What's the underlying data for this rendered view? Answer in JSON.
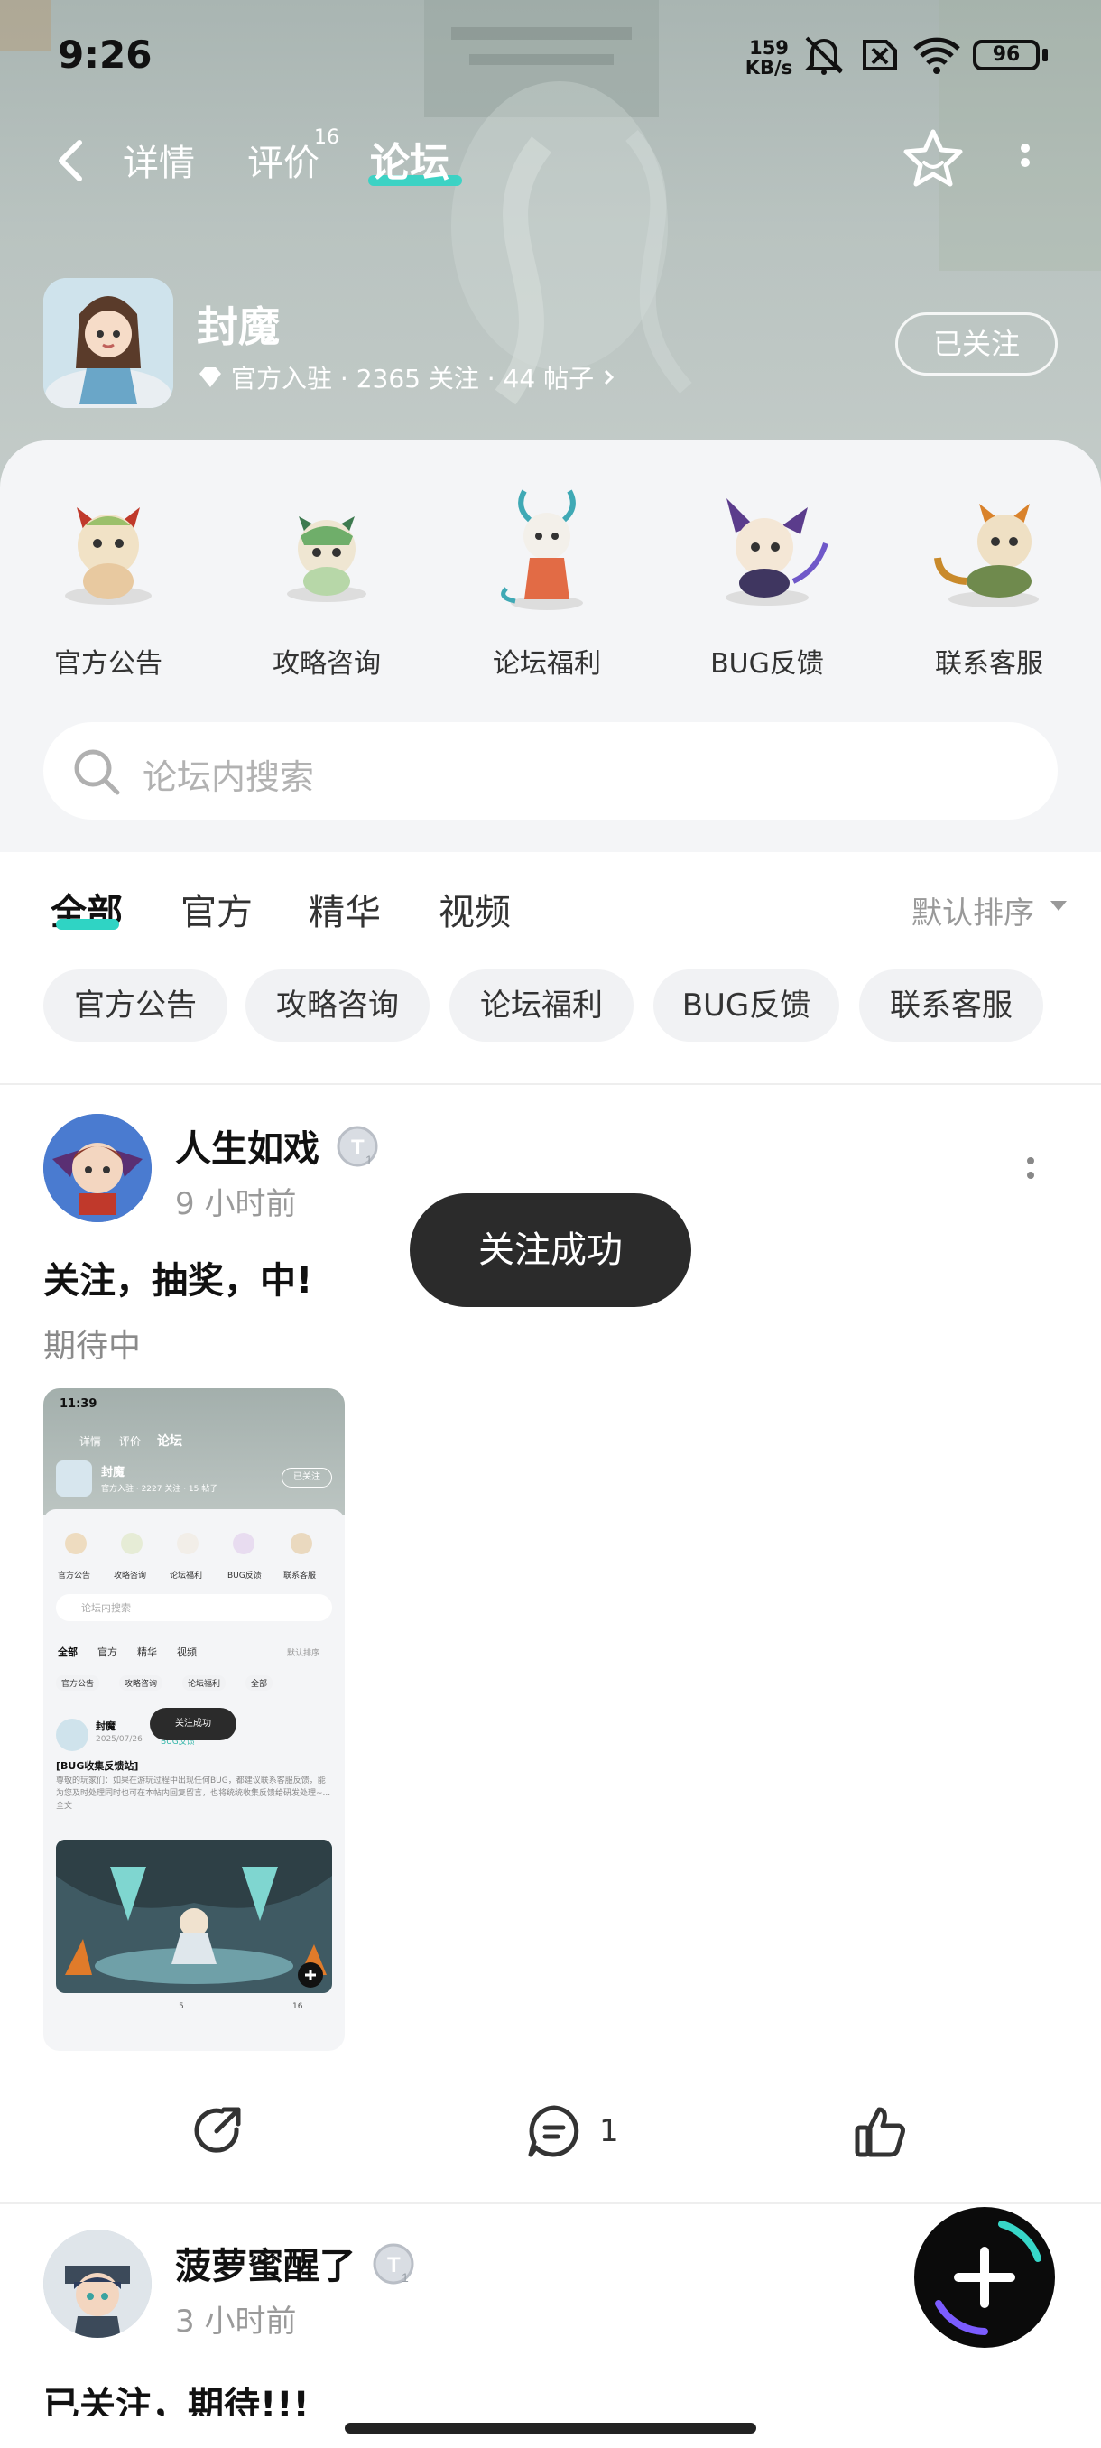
{
  "status_bar": {
    "time": "9:26",
    "net_speed_value": "159",
    "net_speed_unit": "KB/s",
    "battery": "96"
  },
  "nav": {
    "tabs": [
      "详情",
      "评价",
      "论坛"
    ],
    "review_count": "16",
    "active_tab": "论坛"
  },
  "app": {
    "name": "封魔",
    "meta": "官方入驻 · 2365 关注 · 44 帖子",
    "follow_label": "已关注"
  },
  "categories": [
    "官方公告",
    "攻略咨询",
    "论坛福利",
    "BUG反馈",
    "联系客服"
  ],
  "search": {
    "placeholder": "论坛内搜索"
  },
  "feed_tabs": [
    "全部",
    "官方",
    "精华",
    "视频"
  ],
  "sort_label": "默认排序",
  "chips": [
    "官方公告",
    "攻略咨询",
    "论坛福利",
    "BUG反馈",
    "联系客服"
  ],
  "posts": [
    {
      "author": "人生如戏",
      "time": "9 小时前",
      "title": "关注，抽奖，中!",
      "body": "期待中",
      "comment_count": "1",
      "screenshot": {
        "time": "11:39",
        "tabs": [
          "详情",
          "评价",
          "论坛"
        ],
        "app_name": "封魔",
        "app_meta": "官方入驻 · 2227 关注 · 15 帖子",
        "follow_label": "已关注",
        "categories": [
          "官方公告",
          "攻略咨询",
          "论坛福利",
          "BUG反馈",
          "联系客服"
        ],
        "search": "论坛内搜索",
        "feed_tabs": [
          "全部",
          "官方",
          "精华",
          "视频"
        ],
        "sort": "默认排序",
        "chips": [
          "官方公告",
          "攻略咨询",
          "论坛福利",
          "全部"
        ],
        "post_author": "封魔",
        "post_date": "2025/07/26",
        "post_tag": "BUG反馈",
        "toast": "关注成功",
        "post_title": "[BUG收集反馈站]",
        "post_text": "尊敬的玩家们：如果在游玩过程中出现任何BUG，都建议联系客服反馈，能为您及时处理同时也可在本帖内回复留言，也将统统收集反馈给研发处理~...全文",
        "comments": "5",
        "likes": "16"
      }
    },
    {
      "author": "菠萝蜜醒了",
      "time": "3 小时前",
      "title": "已关注，期待!!!"
    }
  ],
  "toast": "关注成功",
  "colors": {
    "accent": "#2fd4c4",
    "toast_bg": "#2b2b2b",
    "chip_bg": "#f1f2f4"
  }
}
